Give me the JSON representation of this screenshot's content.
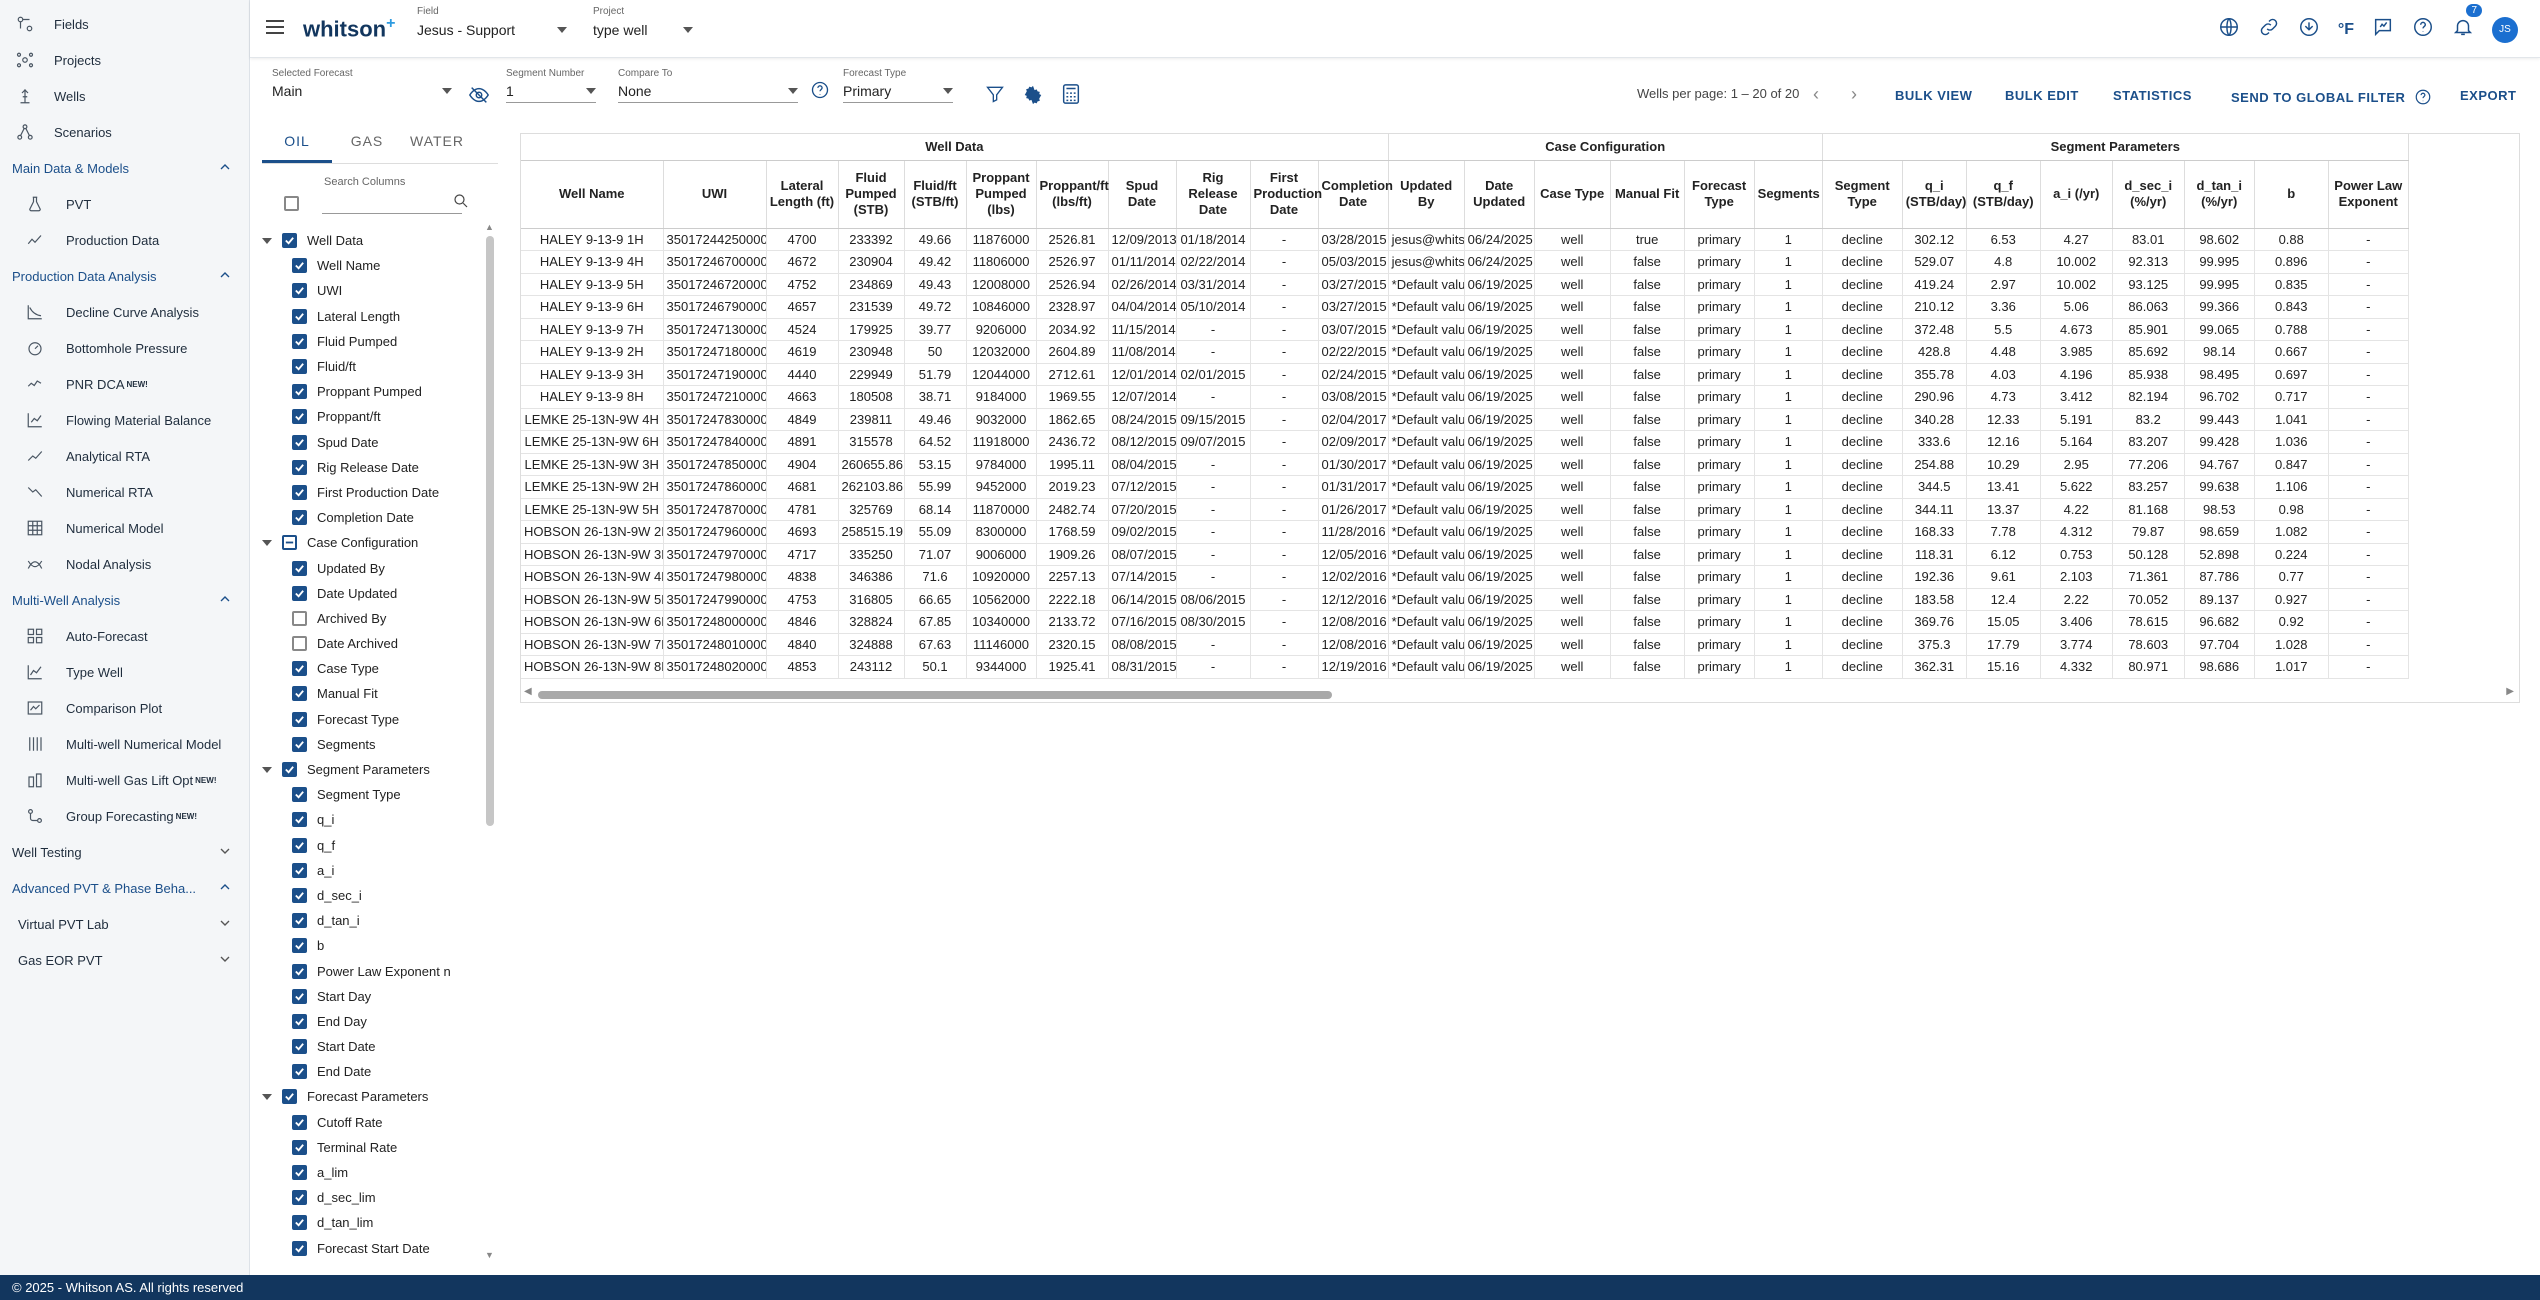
{
  "app": {
    "logo": "whitson",
    "logo_plus": "+",
    "footer": "© 2025 - Whitson AS. All rights reserved"
  },
  "sidebar": {
    "top": [
      {
        "label": "Fields",
        "icon": "fields-icon"
      },
      {
        "label": "Projects",
        "icon": "projects-icon"
      },
      {
        "label": "Wells",
        "icon": "wells-icon"
      },
      {
        "label": "Scenarios",
        "icon": "scenarios-icon"
      }
    ],
    "sections": [
      {
        "label": "Main Data & Models",
        "items": [
          {
            "label": "PVT",
            "icon": "flask-icon"
          },
          {
            "label": "Production Data",
            "icon": "trend-icon"
          }
        ]
      },
      {
        "label": "Production Data Analysis",
        "items": [
          {
            "label": "Decline Curve Analysis",
            "icon": "dca-icon"
          },
          {
            "label": "Bottomhole Pressure",
            "icon": "gauge-icon"
          },
          {
            "label": "PNR DCA",
            "icon": "pnr-icon",
            "badge": "NEW!"
          },
          {
            "label": "Flowing Material Balance",
            "icon": "fmb-icon"
          },
          {
            "label": "Analytical RTA",
            "icon": "rta-icon"
          },
          {
            "label": "Numerical RTA",
            "icon": "nrta-icon"
          },
          {
            "label": "Numerical Model",
            "icon": "grid-icon"
          },
          {
            "label": "Nodal Analysis",
            "icon": "nodal-icon"
          }
        ]
      },
      {
        "label": "Multi-Well Analysis",
        "items": [
          {
            "label": "Auto-Forecast",
            "icon": "autoforecast-icon"
          },
          {
            "label": "Type Well",
            "icon": "typewell-icon"
          },
          {
            "label": "Comparison Plot",
            "icon": "comparison-icon"
          },
          {
            "label": "Multi-well Numerical Model",
            "icon": "multinum-icon"
          },
          {
            "label": "Multi-well Gas Lift Opt",
            "icon": "gaslift-icon",
            "badge": "NEW!"
          },
          {
            "label": "Group Forecasting",
            "icon": "group-icon",
            "badge": "NEW!"
          }
        ]
      }
    ],
    "collapsed": [
      "Well Testing",
      "Advanced PVT & Phase Beha..."
    ],
    "sub": [
      "Virtual PVT Lab",
      "Gas EOR PVT"
    ]
  },
  "topbar": {
    "field_label": "Field",
    "field_value": "Jesus - Support",
    "project_label": "Project",
    "project_value": "type well",
    "notif_count": "7",
    "avatar": "JS",
    "units": "°F"
  },
  "toolbar": {
    "selected_forecast_label": "Selected Forecast",
    "selected_forecast": "Main",
    "segment_number_label": "Segment Number",
    "segment_number": "1",
    "compare_to_label": "Compare To",
    "compare_to": "None",
    "forecast_type_label": "Forecast Type",
    "forecast_type": "Primary",
    "wells_per_page": "Wells per page: 1 – 20 of 20",
    "bulk_view": "BULK VIEW",
    "bulk_edit": "BULK EDIT",
    "statistics": "STATISTICS",
    "send_filter": "SEND TO GLOBAL FILTER",
    "export": "EXPORT"
  },
  "column_panel": {
    "tabs": [
      "OIL",
      "GAS",
      "WATER"
    ],
    "search_label": "Search Columns",
    "groups": [
      {
        "label": "Well Data",
        "state": "on",
        "items": [
          [
            "Well Name",
            1
          ],
          [
            "UWI",
            1
          ],
          [
            "Lateral Length",
            1
          ],
          [
            "Fluid Pumped",
            1
          ],
          [
            "Fluid/ft",
            1
          ],
          [
            "Proppant Pumped",
            1
          ],
          [
            "Proppant/ft",
            1
          ],
          [
            "Spud Date",
            1
          ],
          [
            "Rig Release Date",
            1
          ],
          [
            "First Production Date",
            1
          ],
          [
            "Completion Date",
            1
          ]
        ]
      },
      {
        "label": "Case Configuration",
        "state": "ind",
        "items": [
          [
            "Updated By",
            1
          ],
          [
            "Date Updated",
            1
          ],
          [
            "Archived By",
            0
          ],
          [
            "Date Archived",
            0
          ],
          [
            "Case Type",
            1
          ],
          [
            "Manual Fit",
            1
          ],
          [
            "Forecast Type",
            1
          ],
          [
            "Segments",
            1
          ]
        ]
      },
      {
        "label": "Segment Parameters",
        "state": "on",
        "items": [
          [
            "Segment Type",
            1
          ],
          [
            "q_i",
            1
          ],
          [
            "q_f",
            1
          ],
          [
            "a_i",
            1
          ],
          [
            "d_sec_i",
            1
          ],
          [
            "d_tan_i",
            1
          ],
          [
            "b",
            1
          ],
          [
            "Power Law Exponent n",
            1
          ],
          [
            "Start Day",
            1
          ],
          [
            "End Day",
            1
          ],
          [
            "Start Date",
            1
          ],
          [
            "End Date",
            1
          ]
        ]
      },
      {
        "label": "Forecast Parameters",
        "state": "on",
        "items": [
          [
            "Cutoff Rate",
            1
          ],
          [
            "Terminal Rate",
            1
          ],
          [
            "a_lim",
            1
          ],
          [
            "d_sec_lim",
            1
          ],
          [
            "d_tan_lim",
            1
          ],
          [
            "Forecast Start Date",
            1
          ]
        ]
      }
    ]
  },
  "table": {
    "groups": [
      [
        "Well Data",
        11
      ],
      [
        "Case Configuration",
        6
      ],
      [
        "Segment Parameters",
        8
      ]
    ],
    "columns": [
      "Well Name",
      "UWI",
      "Lateral Length (ft)",
      "Fluid Pumped (STB)",
      "Fluid/ft (STB/ft)",
      "Proppant Pumped (lbs)",
      "Proppant/ft (lbs/ft)",
      "Spud Date",
      "Rig Release Date",
      "First Production Date",
      "Completion Date",
      "Updated By",
      "Date Updated",
      "Case Type",
      "Manual Fit",
      "Forecast Type",
      "Segments",
      "Segment Type",
      "q_i (STB/day)",
      "q_f (STB/day)",
      "a_i (/yr)",
      "d_sec_i (%/yr)",
      "d_tan_i (%/yr)",
      "b",
      "Power Law Exponent"
    ],
    "rows": [
      [
        "HALEY 9-13-9 1H",
        "35017244250000",
        "4700",
        "233392",
        "49.66",
        "11876000",
        "2526.81",
        "12/09/2013",
        "01/18/2014",
        "-",
        "03/28/2015",
        "jesus@whitson",
        "06/24/2025",
        "well",
        "true",
        "primary",
        "1",
        "decline",
        "302.12",
        "6.53",
        "4.27",
        "83.01",
        "98.602",
        "0.88",
        "-"
      ],
      [
        "HALEY 9-13-9 4H",
        "35017246700000",
        "4672",
        "230904",
        "49.42",
        "11806000",
        "2526.97",
        "01/11/2014",
        "02/22/2014",
        "-",
        "05/03/2015",
        "jesus@whitson",
        "06/24/2025",
        "well",
        "false",
        "primary",
        "1",
        "decline",
        "529.07",
        "4.8",
        "10.002",
        "92.313",
        "99.995",
        "0.896",
        "-"
      ],
      [
        "HALEY 9-13-9 5H",
        "35017246720000",
        "4752",
        "234869",
        "49.43",
        "12008000",
        "2526.94",
        "02/26/2014",
        "03/31/2014",
        "-",
        "03/27/2015",
        "*Default value",
        "06/19/2025",
        "well",
        "false",
        "primary",
        "1",
        "decline",
        "419.24",
        "2.97",
        "10.002",
        "93.125",
        "99.995",
        "0.835",
        "-"
      ],
      [
        "HALEY 9-13-9 6H",
        "35017246790000",
        "4657",
        "231539",
        "49.72",
        "10846000",
        "2328.97",
        "04/04/2014",
        "05/10/2014",
        "-",
        "03/27/2015",
        "*Default value",
        "06/19/2025",
        "well",
        "false",
        "primary",
        "1",
        "decline",
        "210.12",
        "3.36",
        "5.06",
        "86.063",
        "99.366",
        "0.843",
        "-"
      ],
      [
        "HALEY 9-13-9 7H",
        "35017247130000",
        "4524",
        "179925",
        "39.77",
        "9206000",
        "2034.92",
        "11/15/2014",
        "-",
        "-",
        "03/07/2015",
        "*Default value",
        "06/19/2025",
        "well",
        "false",
        "primary",
        "1",
        "decline",
        "372.48",
        "5.5",
        "4.673",
        "85.901",
        "99.065",
        "0.788",
        "-"
      ],
      [
        "HALEY 9-13-9 2H",
        "35017247180000",
        "4619",
        "230948",
        "50",
        "12032000",
        "2604.89",
        "11/08/2014",
        "-",
        "-",
        "02/22/2015",
        "*Default value",
        "06/19/2025",
        "well",
        "false",
        "primary",
        "1",
        "decline",
        "428.8",
        "4.48",
        "3.985",
        "85.692",
        "98.14",
        "0.667",
        "-"
      ],
      [
        "HALEY 9-13-9 3H",
        "35017247190000",
        "4440",
        "229949",
        "51.79",
        "12044000",
        "2712.61",
        "12/01/2014",
        "02/01/2015",
        "-",
        "02/24/2015",
        "*Default value",
        "06/19/2025",
        "well",
        "false",
        "primary",
        "1",
        "decline",
        "355.78",
        "4.03",
        "4.196",
        "85.938",
        "98.495",
        "0.697",
        "-"
      ],
      [
        "HALEY 9-13-9 8H",
        "35017247210000",
        "4663",
        "180508",
        "38.71",
        "9184000",
        "1969.55",
        "12/07/2014",
        "-",
        "-",
        "03/08/2015",
        "*Default value",
        "06/19/2025",
        "well",
        "false",
        "primary",
        "1",
        "decline",
        "290.96",
        "4.73",
        "3.412",
        "82.194",
        "96.702",
        "0.717",
        "-"
      ],
      [
        "LEMKE 25-13N-9W 4H",
        "35017247830000",
        "4849",
        "239811",
        "49.46",
        "9032000",
        "1862.65",
        "08/24/2015",
        "09/15/2015",
        "-",
        "02/04/2017",
        "*Default value",
        "06/19/2025",
        "well",
        "false",
        "primary",
        "1",
        "decline",
        "340.28",
        "12.33",
        "5.191",
        "83.2",
        "99.443",
        "1.041",
        "-"
      ],
      [
        "LEMKE 25-13N-9W 6H",
        "35017247840000",
        "4891",
        "315578",
        "64.52",
        "11918000",
        "2436.72",
        "08/12/2015",
        "09/07/2015",
        "-",
        "02/09/2017",
        "*Default value",
        "06/19/2025",
        "well",
        "false",
        "primary",
        "1",
        "decline",
        "333.6",
        "12.16",
        "5.164",
        "83.207",
        "99.428",
        "1.036",
        "-"
      ],
      [
        "LEMKE 25-13N-9W 3H",
        "35017247850000",
        "4904",
        "260655.86",
        "53.15",
        "9784000",
        "1995.11",
        "08/04/2015",
        "-",
        "-",
        "01/30/2017",
        "*Default value",
        "06/19/2025",
        "well",
        "false",
        "primary",
        "1",
        "decline",
        "254.88",
        "10.29",
        "2.95",
        "77.206",
        "94.767",
        "0.847",
        "-"
      ],
      [
        "LEMKE 25-13N-9W 2H",
        "35017247860000",
        "4681",
        "262103.86",
        "55.99",
        "9452000",
        "2019.23",
        "07/12/2015",
        "-",
        "-",
        "01/31/2017",
        "*Default value",
        "06/19/2025",
        "well",
        "false",
        "primary",
        "1",
        "decline",
        "344.5",
        "13.41",
        "5.622",
        "83.257",
        "99.638",
        "1.106",
        "-"
      ],
      [
        "LEMKE 25-13N-9W 5H",
        "35017247870000",
        "4781",
        "325769",
        "68.14",
        "11870000",
        "2482.74",
        "07/20/2015",
        "-",
        "-",
        "01/26/2017",
        "*Default value",
        "06/19/2025",
        "well",
        "false",
        "primary",
        "1",
        "decline",
        "344.11",
        "13.37",
        "4.22",
        "81.168",
        "98.53",
        "0.98",
        "-"
      ],
      [
        "HOBSON 26-13N-9W 2H",
        "35017247960000",
        "4693",
        "258515.19",
        "55.09",
        "8300000",
        "1768.59",
        "09/02/2015",
        "-",
        "-",
        "11/28/2016",
        "*Default value",
        "06/19/2025",
        "well",
        "false",
        "primary",
        "1",
        "decline",
        "168.33",
        "7.78",
        "4.312",
        "79.87",
        "98.659",
        "1.082",
        "-"
      ],
      [
        "HOBSON 26-13N-9W 3H",
        "35017247970000",
        "4717",
        "335250",
        "71.07",
        "9006000",
        "1909.26",
        "08/07/2015",
        "-",
        "-",
        "12/05/2016",
        "*Default value",
        "06/19/2025",
        "well",
        "false",
        "primary",
        "1",
        "decline",
        "118.31",
        "6.12",
        "0.753",
        "50.128",
        "52.898",
        "0.224",
        "-"
      ],
      [
        "HOBSON 26-13N-9W 4H",
        "35017247980000",
        "4838",
        "346386",
        "71.6",
        "10920000",
        "2257.13",
        "07/14/2015",
        "-",
        "-",
        "12/02/2016",
        "*Default value",
        "06/19/2025",
        "well",
        "false",
        "primary",
        "1",
        "decline",
        "192.36",
        "9.61",
        "2.103",
        "71.361",
        "87.786",
        "0.77",
        "-"
      ],
      [
        "HOBSON 26-13N-9W 5H",
        "35017247990000",
        "4753",
        "316805",
        "66.65",
        "10562000",
        "2222.18",
        "06/14/2015",
        "08/06/2015",
        "-",
        "12/12/2016",
        "*Default value",
        "06/19/2025",
        "well",
        "false",
        "primary",
        "1",
        "decline",
        "183.58",
        "12.4",
        "2.22",
        "70.052",
        "89.137",
        "0.927",
        "-"
      ],
      [
        "HOBSON 26-13N-9W 6H",
        "35017248000000",
        "4846",
        "328824",
        "67.85",
        "10340000",
        "2133.72",
        "07/16/2015",
        "08/30/2015",
        "-",
        "12/08/2016",
        "*Default value",
        "06/19/2025",
        "well",
        "false",
        "primary",
        "1",
        "decline",
        "369.76",
        "15.05",
        "3.406",
        "78.615",
        "96.682",
        "0.92",
        "-"
      ],
      [
        "HOBSON 26-13N-9W 7H",
        "35017248010000",
        "4840",
        "324888",
        "67.63",
        "11146000",
        "2320.15",
        "08/08/2015",
        "-",
        "-",
        "12/08/2016",
        "*Default value",
        "06/19/2025",
        "well",
        "false",
        "primary",
        "1",
        "decline",
        "375.3",
        "17.79",
        "3.774",
        "78.603",
        "97.704",
        "1.028",
        "-"
      ],
      [
        "HOBSON 26-13N-9W 8H",
        "35017248020000",
        "4853",
        "243112",
        "50.1",
        "9344000",
        "1925.41",
        "08/31/2015",
        "-",
        "-",
        "12/19/2016",
        "*Default value",
        "06/19/2025",
        "well",
        "false",
        "primary",
        "1",
        "decline",
        "362.31",
        "15.16",
        "4.332",
        "80.971",
        "98.686",
        "1.017",
        "-"
      ]
    ]
  },
  "colors": {
    "brand": "#1b4f8a",
    "footer": "#12365e",
    "sidebar": "#f4f6f8"
  }
}
